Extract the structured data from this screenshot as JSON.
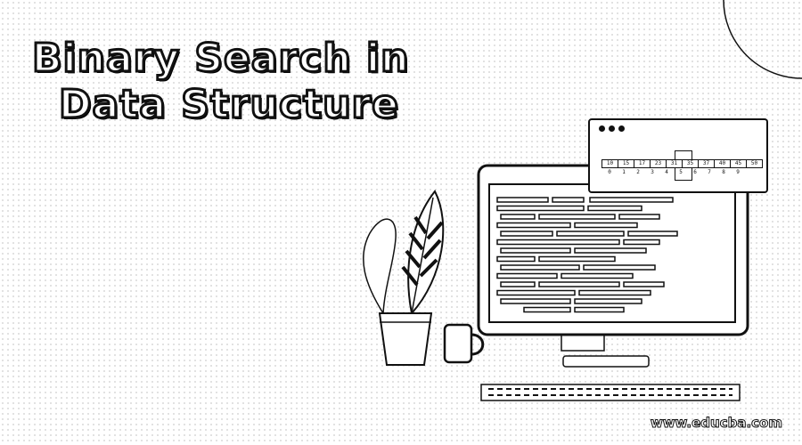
{
  "title": {
    "line1": "Binary Search in",
    "line2": "Data Structure"
  },
  "array": {
    "values": [
      "10",
      "15",
      "17",
      "23",
      "31",
      "35",
      "37",
      "40",
      "45",
      "50"
    ],
    "indices": [
      "0",
      "1",
      "2",
      "3",
      "4",
      "5",
      "6",
      "7",
      "8",
      "9"
    ],
    "highlighted_index": 5
  },
  "watermark": "www.educba.com",
  "icons": [
    "plant-icon",
    "mug-icon",
    "monitor-icon",
    "keyboard-icon",
    "browser-window-icon"
  ]
}
